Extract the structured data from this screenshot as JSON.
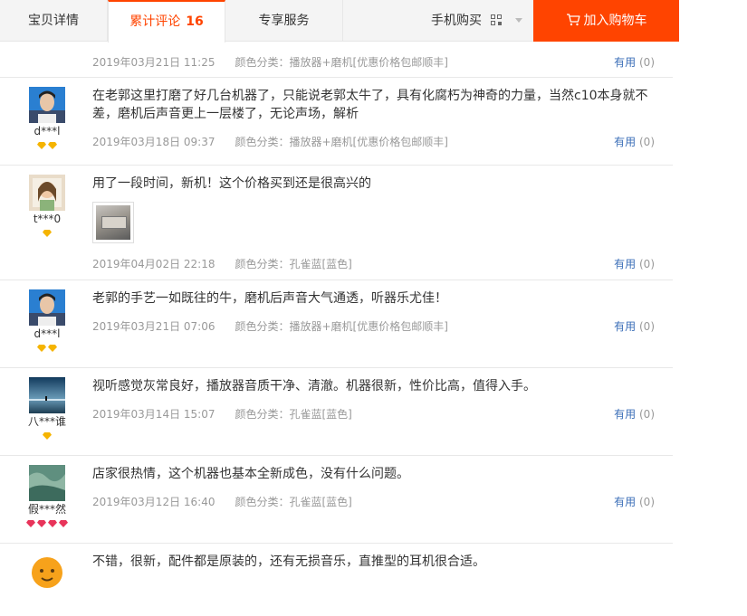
{
  "tabs": {
    "detail": "宝贝详情",
    "reviews": "累计评论",
    "reviews_count": "16",
    "service": "专享服务",
    "mobile": "手机购买",
    "add_to_cart": "加入购物车"
  },
  "colors": {
    "accent": "#ff4400",
    "link": "#3c6fb8",
    "muted": "#999999"
  },
  "reviews": [
    {
      "date": "2019年03月21日 11:25",
      "sku": "颜色分类：播放器+磨机[优惠价格包邮顺丰]",
      "useful_label": "有用",
      "useful_count": "(0)"
    },
    {
      "user": "d***l",
      "text": "在老郭这里打磨了好几台机器了，只能说老郭太牛了，具有化腐朽为神奇的力量，当然c10本身就不差，磨机后声音更上一层楼了，无论声场，解析",
      "date": "2019年03月18日 09:37",
      "sku": "颜色分类：播放器+磨机[优惠价格包邮顺丰]",
      "useful_label": "有用",
      "useful_count": "(0)",
      "gems": 2
    },
    {
      "user": "t***0",
      "text": "用了一段时间，新机！这个价格买到还是很高兴的",
      "date": "2019年04月02日 22:18",
      "sku": "颜色分类：孔雀蓝[蓝色]",
      "useful_label": "有用",
      "useful_count": "(0)",
      "gems": 1
    },
    {
      "user": "d***l",
      "text": "老郭的手艺一如既往的牛，磨机后声音大气通透，听器乐尤佳！",
      "date": "2019年03月21日 07:06",
      "sku": "颜色分类：播放器+磨机[优惠价格包邮顺丰]",
      "useful_label": "有用",
      "useful_count": "(0)",
      "gems": 2
    },
    {
      "user": "八***谁",
      "text": "视听感觉灰常良好，播放器音质干净、清澈。机器很新，性价比高，值得入手。",
      "date": "2019年03月14日 15:07",
      "sku": "颜色分类：孔雀蓝[蓝色]",
      "useful_label": "有用",
      "useful_count": "(0)",
      "gems": 1
    },
    {
      "user": "假***然",
      "text": "店家很热情，这个机器也基本全新成色，没有什么问题。",
      "date": "2019年03月12日 16:40",
      "sku": "颜色分类：孔雀蓝[蓝色]",
      "useful_label": "有用",
      "useful_count": "(0)",
      "gems": 4
    },
    {
      "text": "不错，很新，配件都是原装的，还有无损音乐，直推型的耳机很合适。"
    }
  ]
}
